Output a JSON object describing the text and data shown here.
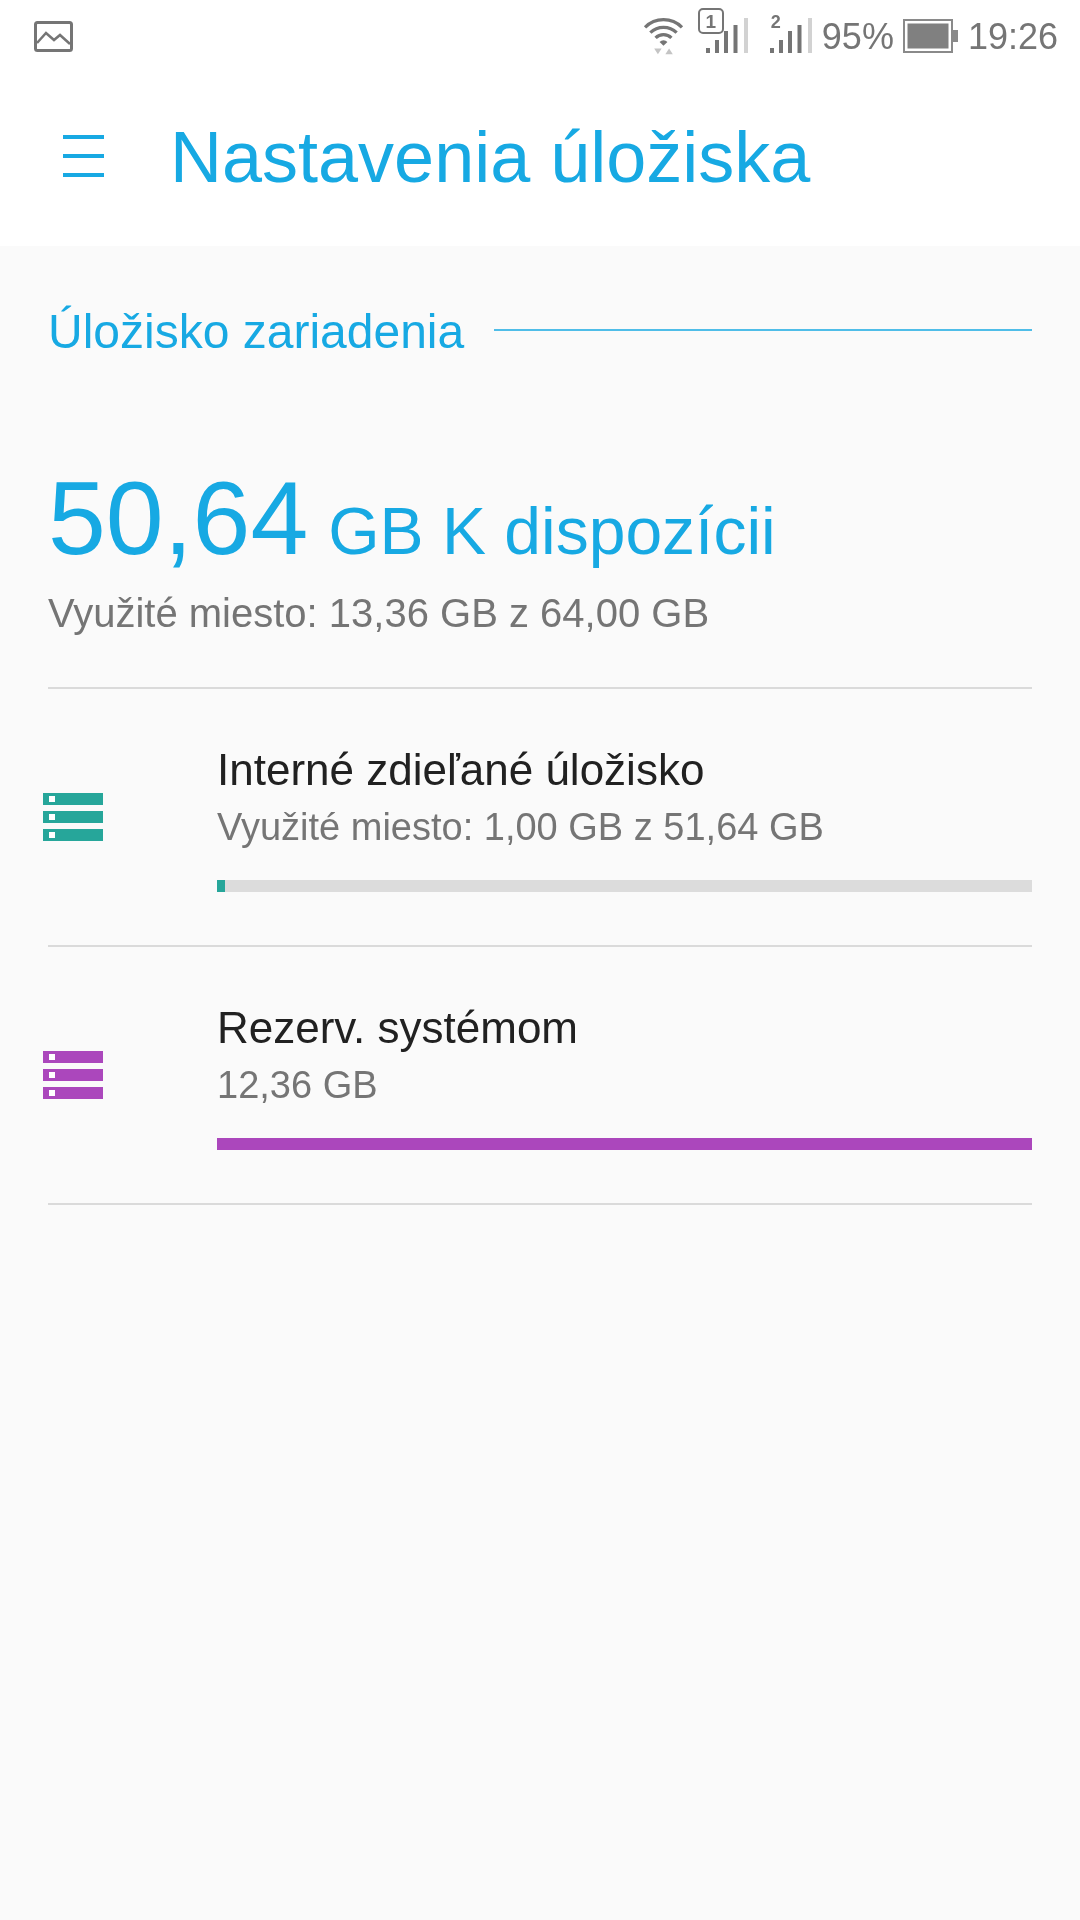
{
  "status_bar": {
    "sim_slots": [
      {
        "label": "1",
        "kind": "boxed"
      },
      {
        "label": "2",
        "kind": "plain"
      }
    ],
    "battery_percent": "95%",
    "time": "19:26"
  },
  "app_bar": {
    "title": "Nastavenia úložiska"
  },
  "section": {
    "title": "Úložisko zariadenia"
  },
  "summary": {
    "available_amount": "50,64",
    "available_unit": "GB K dispozícii",
    "used": "Využité miesto: 13,36 GB z 64,00 GB"
  },
  "volumes": [
    {
      "title": "Interné zdieľané úložisko",
      "subtitle": "Využité miesto: 1,00 GB z 51,64 GB",
      "level": 0.01,
      "color": "#26a69a"
    },
    {
      "title": "Rezerv. systémom",
      "subtitle": "12,36 GB",
      "level": 1,
      "color": "#ab47bc"
    }
  ]
}
